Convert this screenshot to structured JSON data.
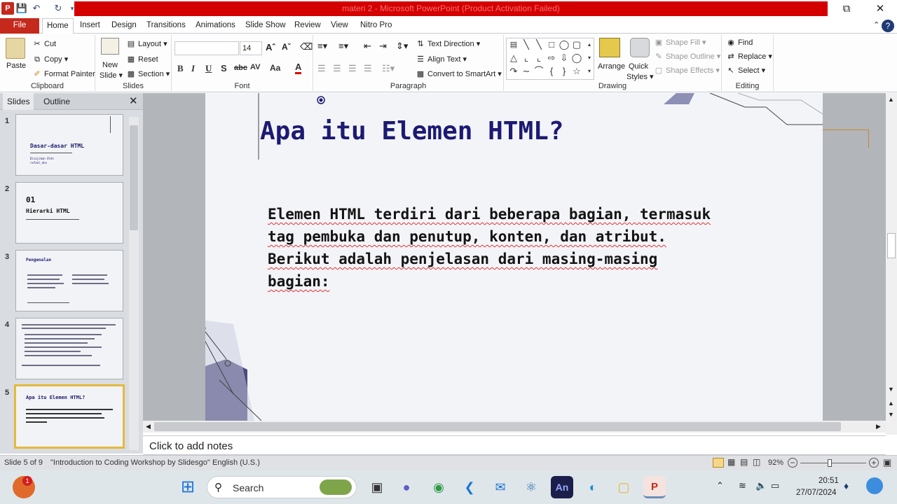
{
  "window": {
    "title": "materi 2 - Microsoft PowerPoint (Product Activation Failed)"
  },
  "tabs": [
    "File",
    "Home",
    "Insert",
    "Design",
    "Transitions",
    "Animations",
    "Slide Show",
    "Review",
    "View",
    "Nitro Pro"
  ],
  "ribbon": {
    "clipboard": {
      "label": "Clipboard",
      "paste": "Paste",
      "cut": "Cut",
      "copy": "Copy",
      "format_painter": "Format Painter"
    },
    "slides": {
      "label": "Slides",
      "new_slide": "New",
      "new_slide2": "Slide",
      "layout": "Layout",
      "reset": "Reset",
      "section": "Section"
    },
    "font": {
      "label": "Font",
      "font_name": "",
      "font_size": "14",
      "bold": "B",
      "italic": "I",
      "underline": "U",
      "shadow": "S",
      "strike": "abc",
      "spacing": "AV",
      "case": "Aa",
      "color": "A"
    },
    "paragraph": {
      "label": "Paragraph",
      "text_direction": "Text Direction",
      "align_text": "Align Text",
      "convert_smartart": "Convert to SmartArt"
    },
    "drawing": {
      "label": "Drawing",
      "arrange": "Arrange",
      "quick_styles": "Quick",
      "quick_styles2": "Styles",
      "shape_fill": "Shape Fill",
      "shape_outline": "Shape Outline",
      "shape_effects": "Shape Effects"
    },
    "editing": {
      "label": "Editing",
      "find": "Find",
      "replace": "Replace",
      "select": "Select"
    }
  },
  "leftpane": {
    "tab_slides": "Slides",
    "tab_outline": "Outline",
    "thumbs": [
      {
        "num": "1",
        "title": "Dasar-dasar HTML",
        "sub1": "Disajikan Oleh",
        "sub2": "rafael_dev"
      },
      {
        "num": "2",
        "title": "01",
        "title2": "Hierarki HTML"
      },
      {
        "num": "3",
        "title": "Pengenalan"
      },
      {
        "num": "4",
        "title": ""
      },
      {
        "num": "5",
        "title": "Apa itu Elemen HTML?"
      }
    ]
  },
  "slide": {
    "title": "Apa itu Elemen HTML?",
    "body_lines": [
      "Elemen HTML terdiri dari beberapa bagian, termasuk",
      "tag pembuka dan penutup, konten, dan atribut.",
      "Berikut adalah penjelasan dari masing-masing",
      "bagian:"
    ]
  },
  "notes": {
    "placeholder": "Click to add notes"
  },
  "status": {
    "slide": "Slide 5 of 9",
    "theme": "\"Introduction to Coding Workshop by Slidesgo\"",
    "language": "English (U.S.)",
    "zoom": "92%"
  },
  "taskbar": {
    "search": "Search",
    "time": "20:51",
    "date": "27/07/2024",
    "badge": "1"
  },
  "colors": {
    "accent_red": "#d40000",
    "file_tab": "#c4291c",
    "slide_title": "#1c1a72"
  }
}
